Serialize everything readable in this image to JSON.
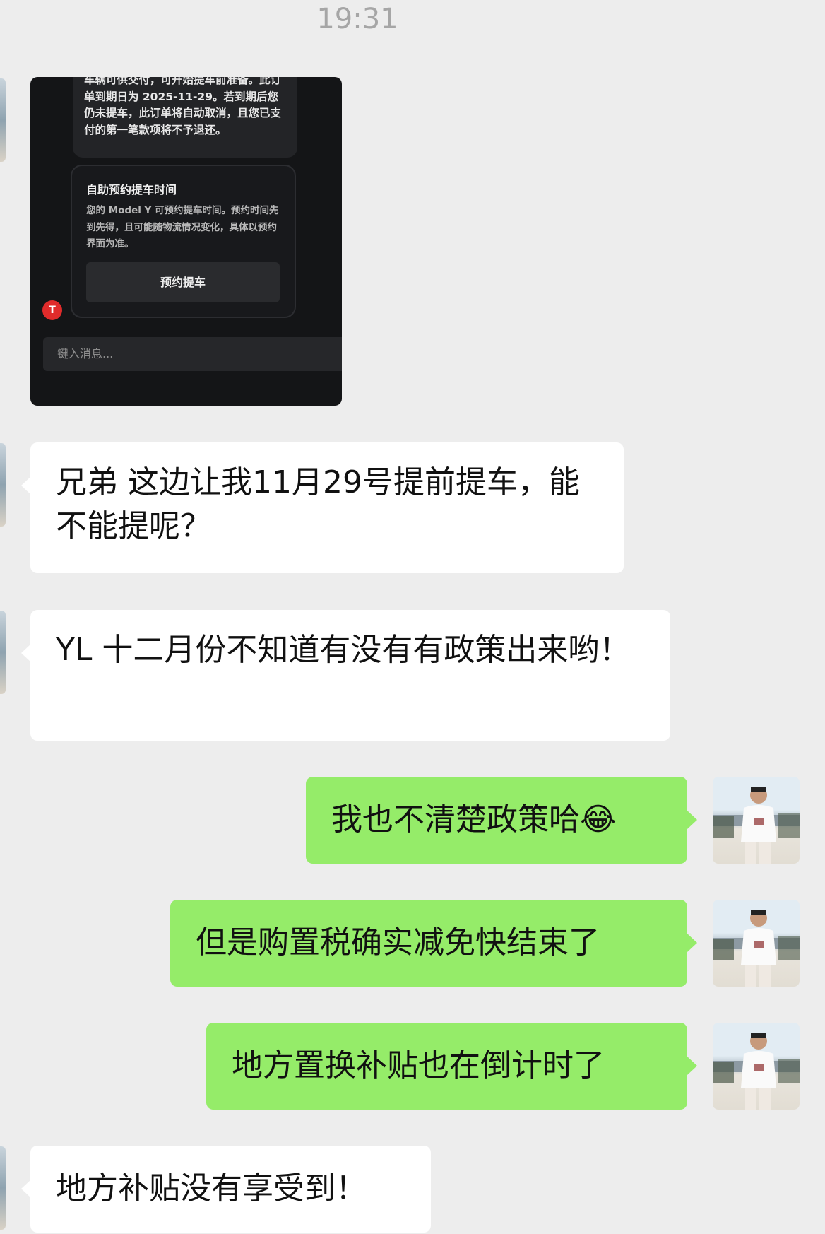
{
  "status": {
    "time": "19:31"
  },
  "image_message": {
    "notice_text": "车辆可供交付，可开始提车前准备。此订单到期日为 2025-11-29。若到期后您仍未提车，此订单将自动取消，且您已支付的第一笔款项将不予退还。",
    "card_title": "自助预约提车时间",
    "card_body": "您的 Model Y 可预约提车时间。预约时间先到先得，且可能随物流情况变化，具体以预约界面为准。",
    "card_button": "预约提车",
    "brand_icon": "tesla-logo-icon",
    "input_placeholder": "键入消息..."
  },
  "messages": [
    {
      "side": "left",
      "text": "兄弟 这边让我11月29号提前提车，能不能提呢？"
    },
    {
      "side": "left",
      "text": "YL 十二月份不知道有没有有政策出来哟！"
    },
    {
      "side": "right",
      "text": "我也不清楚政策哈",
      "emoji": "😂"
    },
    {
      "side": "right",
      "text": "但是购置税确实减免快结束了"
    },
    {
      "side": "right",
      "text": "地方置换补贴也在倒计时了"
    },
    {
      "side": "left",
      "text": "地方补贴没有享受到！"
    }
  ],
  "colors": {
    "sent_bubble": "#95ec69",
    "received_bubble": "#ffffff",
    "background": "#ededed"
  }
}
